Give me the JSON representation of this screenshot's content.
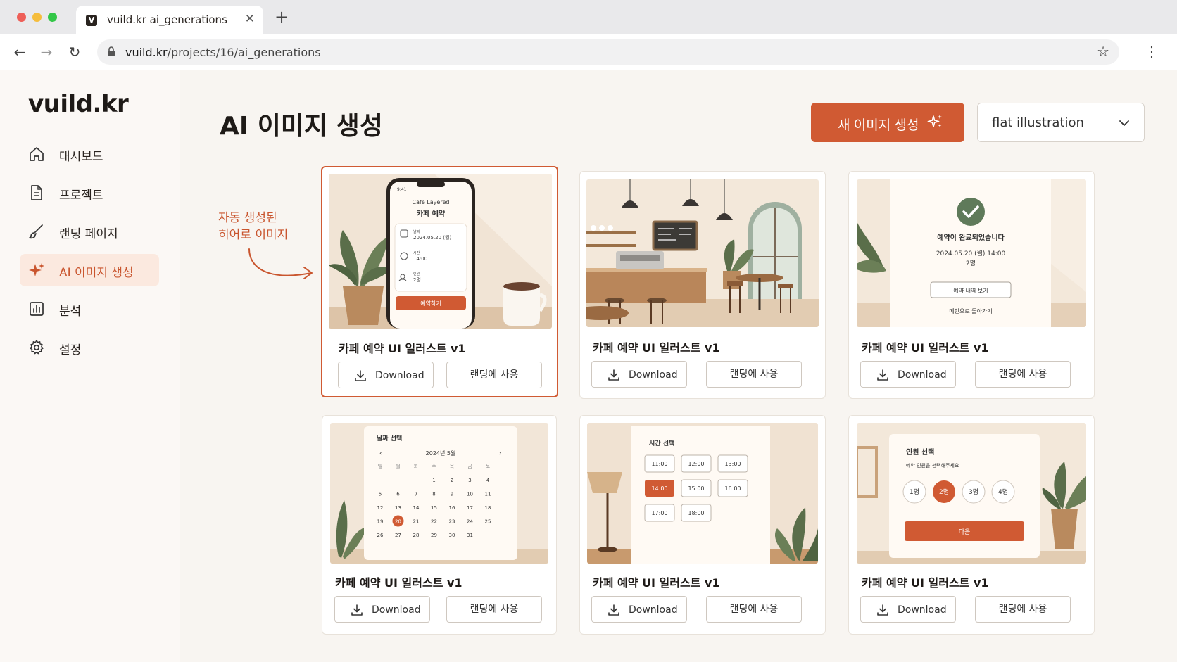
{
  "browser": {
    "tab_title": "vuild.kr ai_generations",
    "favicon": "V",
    "url_domain": "vuild.kr",
    "url_path": "/projects/16/ai_generations"
  },
  "sidebar": {
    "logo": "vuild.kr",
    "items": [
      {
        "label": "대시보드",
        "icon": "home-icon"
      },
      {
        "label": "프로젝트",
        "icon": "document-icon"
      },
      {
        "label": "랜딩 페이지",
        "icon": "brush-icon"
      },
      {
        "label": "AI 이미지 생성",
        "icon": "sparkle-icon",
        "active": true
      },
      {
        "label": "분석",
        "icon": "chart-icon"
      },
      {
        "label": "설정",
        "icon": "gear-icon"
      }
    ]
  },
  "header": {
    "title": "AI 이미지 생성",
    "generate_button": "새 이미지 생성",
    "style_select": "flat illustration"
  },
  "annotation": "자동 생성된\n히어로 이미지",
  "cards": [
    {
      "title": "카페 예약 UI 일러스트 v1",
      "download": "Download",
      "use": "랜딩에 사용",
      "highlight": true,
      "scene": {
        "app_name": "Cafe Layered",
        "heading": "카페 예약",
        "date_label": "날짜",
        "date": "2024.05.20 (월)",
        "time_label": "시간",
        "time": "14:00",
        "people_label": "인원",
        "people": "2명",
        "cta": "예약하기",
        "status_time": "9:41"
      }
    },
    {
      "title": "카페 예약 UI 일러스트 v1",
      "download": "Download",
      "use": "랜딩에 사용"
    },
    {
      "title": "카페 예약 UI 일러스트 v1",
      "download": "Download",
      "use": "랜딩에 사용",
      "scene": {
        "heading": "예약이 완료되었습니다",
        "line1": "2024.05.20 (월) 14:00",
        "line2": "2명",
        "button": "예약 내역 보기",
        "link": "메인으로 돌아가기"
      }
    },
    {
      "title": "카페 예약 UI 일러스트 v1",
      "download": "Download",
      "use": "랜딩에 사용",
      "scene": {
        "heading": "날짜 선택",
        "month": "2024년 5월",
        "weekdays": [
          "일",
          "월",
          "화",
          "수",
          "목",
          "금",
          "토"
        ],
        "selected": "20"
      }
    },
    {
      "title": "카페 예약 UI 일러스트 v1",
      "download": "Download",
      "use": "랜딩에 사용",
      "scene": {
        "heading": "시간 선택",
        "slots": [
          "11:00",
          "12:00",
          "13:00",
          "14:00",
          "15:00",
          "16:00",
          "17:00",
          "18:00"
        ],
        "selected": "14:00"
      }
    },
    {
      "title": "카페 예약 UI 일러스트 v1",
      "download": "Download",
      "use": "랜딩에 사용",
      "scene": {
        "heading": "인원 선택",
        "sub": "예약 인원을 선택해주세요",
        "options": [
          "1명",
          "2명",
          "3명",
          "4명"
        ],
        "selected": "2명",
        "button": "다음"
      }
    }
  ],
  "colors": {
    "accent": "#d05a33",
    "accent_soft": "#fbe9df",
    "plant": "#5a6e4a",
    "pot": "#b98a5e",
    "wall": "#f4e9dc"
  }
}
